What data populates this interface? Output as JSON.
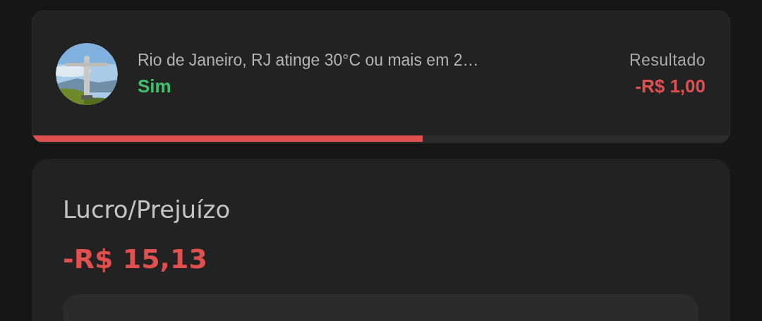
{
  "position": {
    "title": "Rio de Janeiro, RJ atinge 30°C ou mais em 2…",
    "outcome": "Sim",
    "result_label": "Resultado",
    "result_value": "-R$ 1,00",
    "level": 0.56
  },
  "summary": {
    "title": "Lucro/Prejuízo",
    "value": "-R$ 15,13"
  }
}
